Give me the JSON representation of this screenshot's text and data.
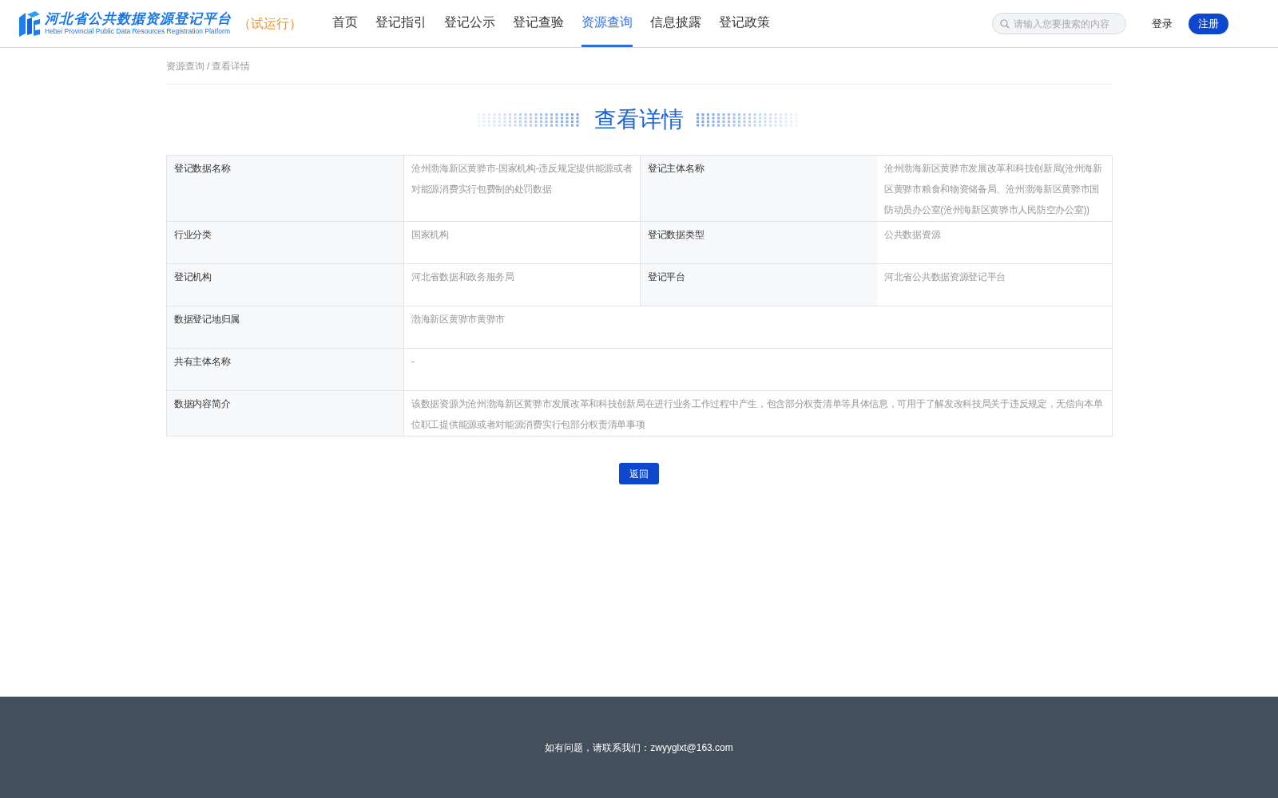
{
  "header": {
    "logo_title": "河北省公共数据资源登记平台",
    "logo_subtitle": "Hebei Provincial Public Data Resources Registration Platform",
    "badge": "（试运行）",
    "nav": [
      {
        "label": "首页",
        "selected": false
      },
      {
        "label": "登记指引",
        "selected": false
      },
      {
        "label": "登记公示",
        "selected": false
      },
      {
        "label": "登记查验",
        "selected": false
      },
      {
        "label": "资源查询",
        "selected": true
      },
      {
        "label": "信息披露",
        "selected": false
      },
      {
        "label": "登记政策",
        "selected": false
      }
    ],
    "search": {
      "placeholder": "请输入您要搜索的内容"
    },
    "login": "登录",
    "register": "注册"
  },
  "breadcrumb": {
    "parent": "资源查询",
    "separator": "/",
    "current": "查看详情"
  },
  "title": "查看详情",
  "details": [
    {
      "cells": [
        {
          "label": "登记数据名称",
          "value": "沧州渤海新区黄骅市-国家机构-违反规定提供能源或者对能源消费实行包费制的处罚数据"
        },
        {
          "label": "登记主体名称",
          "value": "沧州渤海新区黄骅市发展改革和科技创新局(沧州海新区黄骅市粮食和物资储备局、沧州渤海新区黄骅市国防动员办公室(沧州海新区黄骅市人民防空办公室))"
        }
      ]
    },
    {
      "cells": [
        {
          "label": "行业分类",
          "value": "国家机构"
        },
        {
          "label": "登记数据类型",
          "value": "公共数据资源"
        }
      ]
    },
    {
      "cells": [
        {
          "label": "登记机构",
          "value": "河北省数据和政务服务局"
        },
        {
          "label": "登记平台",
          "value": "河北省公共数据资源登记平台"
        }
      ]
    },
    {
      "cells": [
        {
          "label": "数据登记地归属",
          "value": "渤海新区黄骅市黄骅市"
        }
      ]
    },
    {
      "cells": [
        {
          "label": "共有主体名称",
          "value": "-"
        }
      ]
    },
    {
      "cells": [
        {
          "label": "数据内容简介",
          "value": "该数据资源为沧州渤海新区黄骅市发展改革和科技创新局在进行业务工作过程中产生，包含部分权责清单等具体信息，可用于了解发改科技局关于违反规定，无偿向本单位职工提供能源或者对能源消费实行包部分权责清单事项"
        }
      ]
    }
  ],
  "back_button": "返回",
  "footer": "如有问题，请联系我们：zwyyglxt@163.com"
}
